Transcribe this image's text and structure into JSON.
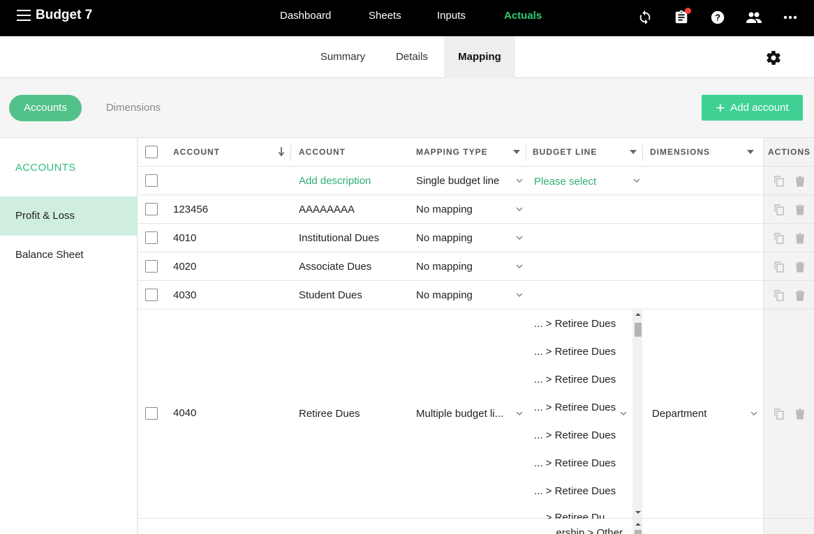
{
  "app": {
    "title": "Budget 7"
  },
  "nav": {
    "items": [
      "Dashboard",
      "Sheets",
      "Inputs",
      "Actuals"
    ],
    "active": "Actuals"
  },
  "subtabs": [
    "Summary",
    "Details",
    "Mapping"
  ],
  "pills": {
    "active": "Accounts",
    "inactive": "Dimensions"
  },
  "add_button": "Add account",
  "sidebar": {
    "heading": "ACCOUNTS",
    "items": [
      "Profit & Loss",
      "Balance Sheet"
    ]
  },
  "table": {
    "headers": [
      "ACCOUNT",
      "ACCOUNT",
      "MAPPING TYPE",
      "BUDGET LINE",
      "DIMENSIONS",
      "ACTIONS"
    ],
    "new_row": {
      "description": "Add description",
      "mapping": "Single budget line",
      "budget": "Please select"
    },
    "rows": [
      {
        "code": "123456",
        "name": "AAAAAAAA",
        "mapping": "No mapping"
      },
      {
        "code": "4010",
        "name": "Institutional Dues",
        "mapping": "No mapping"
      },
      {
        "code": "4020",
        "name": "Associate Dues",
        "mapping": "No mapping"
      },
      {
        "code": "4030",
        "name": "Student Dues",
        "mapping": "No mapping"
      }
    ],
    "multi_row": {
      "code": "4040",
      "name": "Retiree Dues",
      "mapping": "Multiple budget li...",
      "dimension": "Department",
      "budget_lines": [
        "... > Retiree Dues",
        "... > Retiree Dues",
        "... > Retiree Dues",
        "... > Retiree Dues",
        "... > Retiree Dues",
        "... > Retiree Dues",
        "... > Retiree Dues",
        "... > Retiree Du"
      ]
    },
    "partial_row": {
      "budget_line": "...ership > Other"
    }
  },
  "colors": {
    "accent": "#2ecc71",
    "pill": "#52c18a",
    "button": "#3fd194",
    "selected": "#cfeee0"
  }
}
